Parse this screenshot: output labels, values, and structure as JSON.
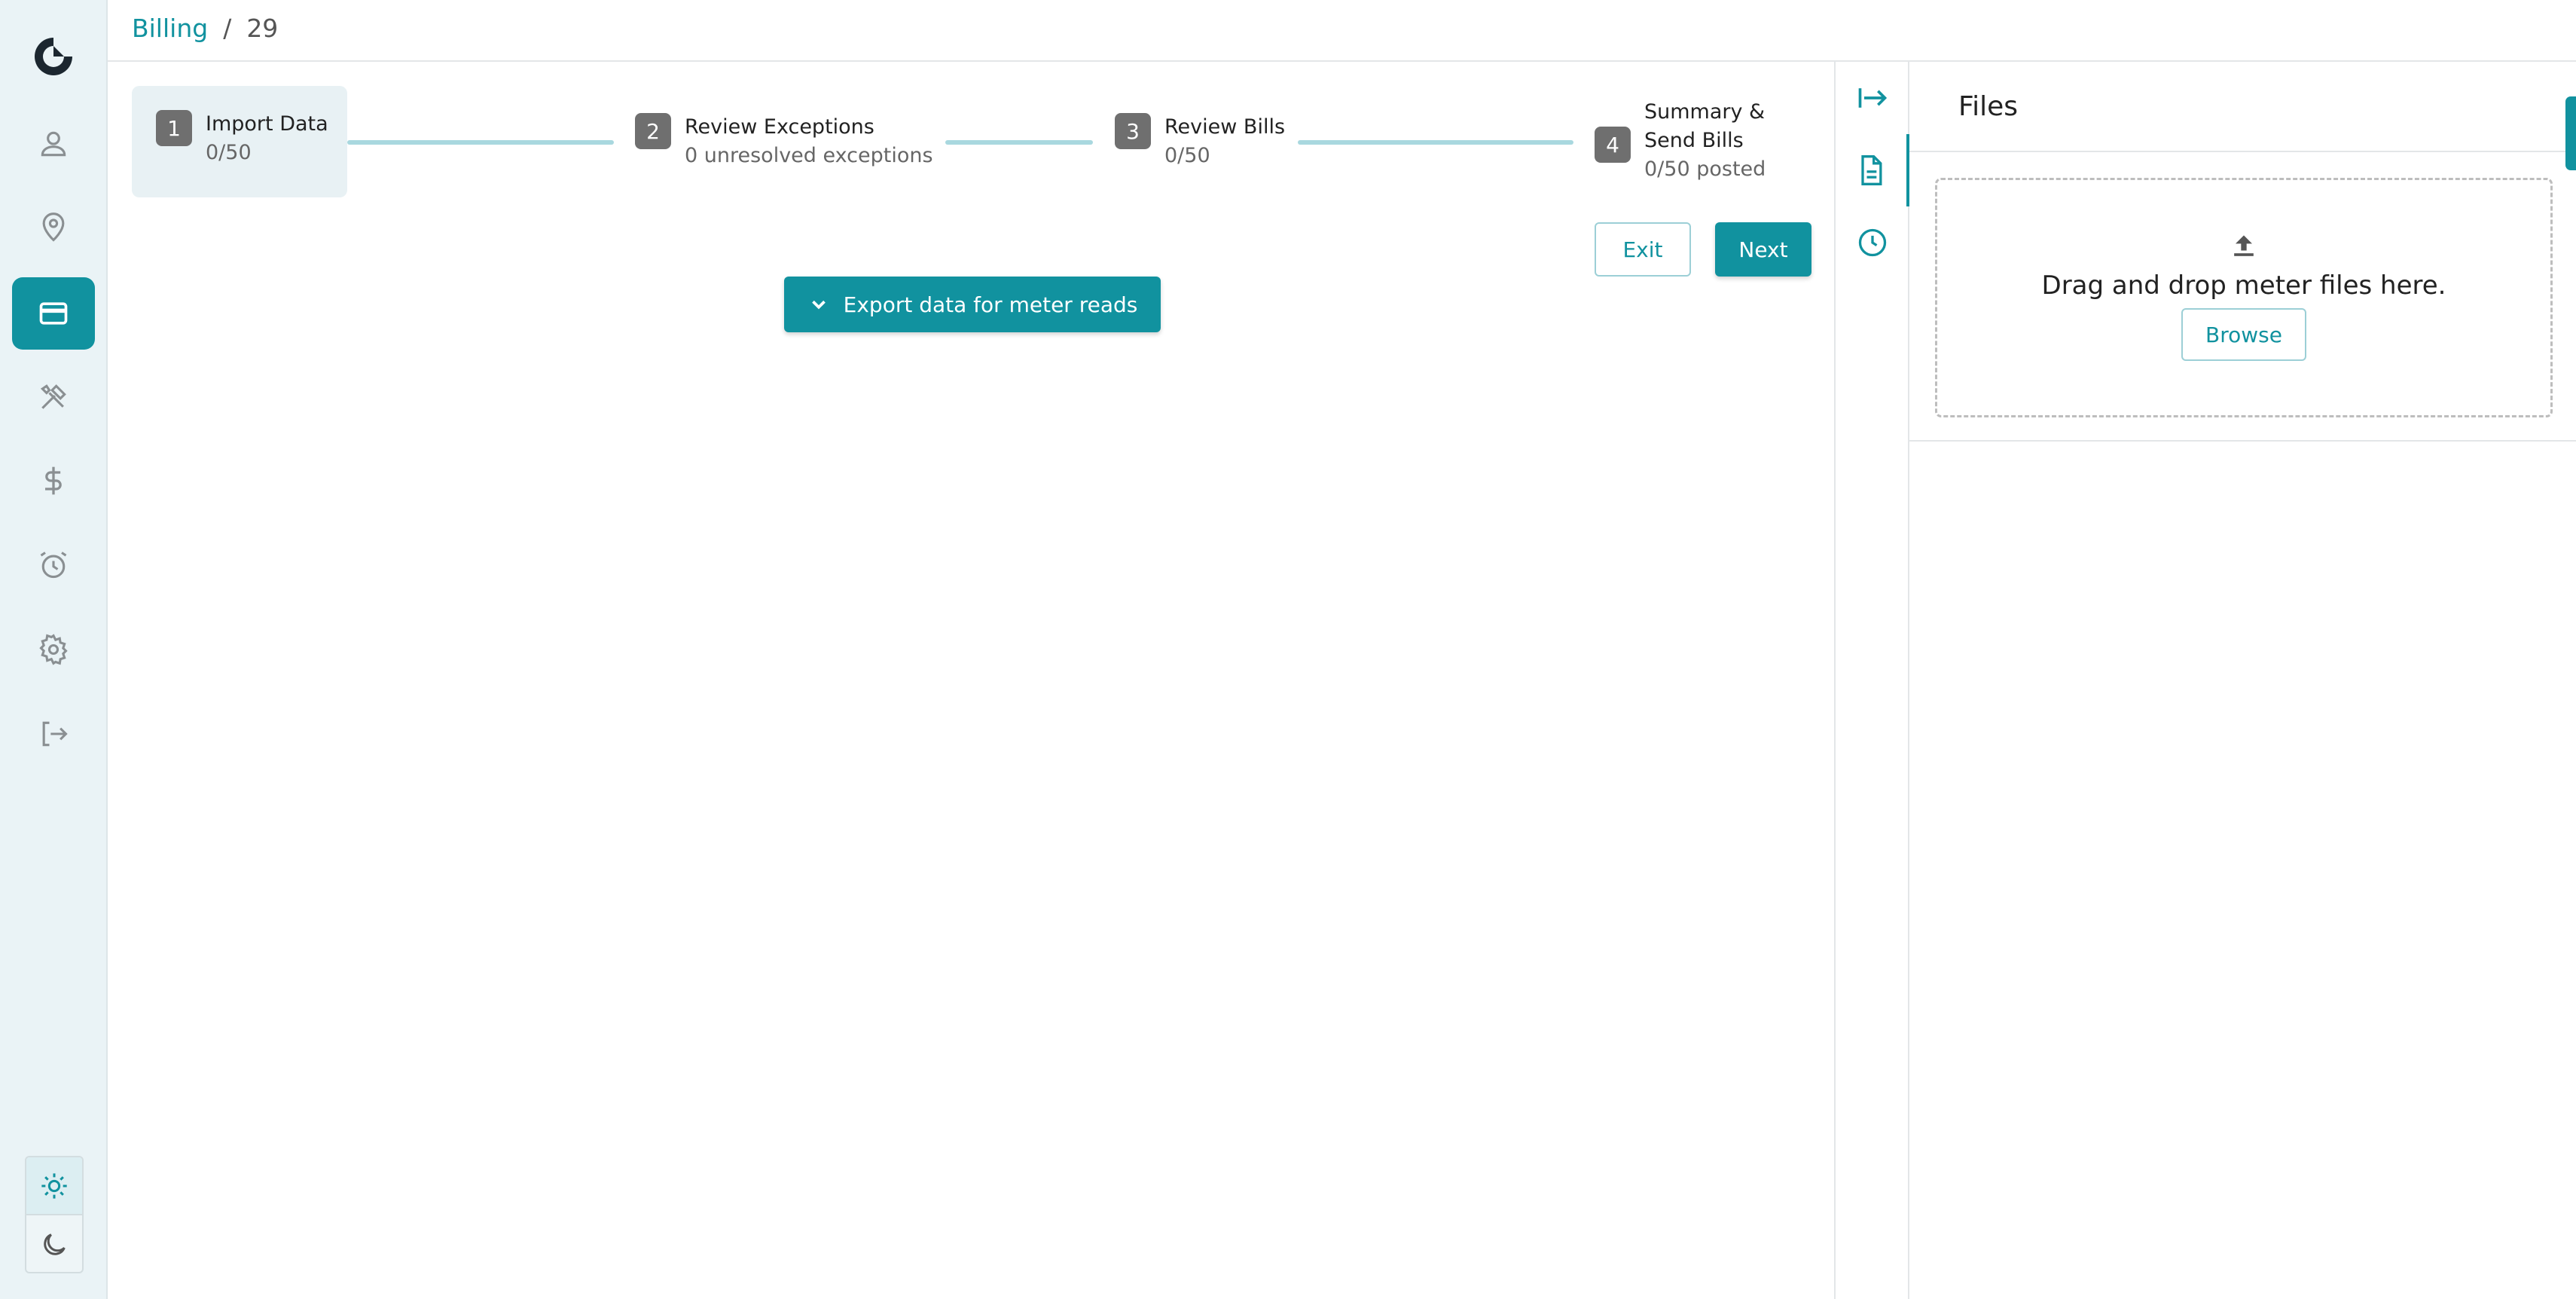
{
  "breadcrumb": {
    "section": "Billing",
    "separator": "/",
    "current": "29"
  },
  "sidebar": {
    "items": [
      {
        "name": "user-icon"
      },
      {
        "name": "location-icon"
      },
      {
        "name": "credit-card-icon",
        "active": true
      },
      {
        "name": "tools-icon"
      },
      {
        "name": "dollar-icon"
      },
      {
        "name": "alarm-clock-icon"
      },
      {
        "name": "gear-icon"
      },
      {
        "name": "logout-icon"
      }
    ],
    "theme": {
      "light": "sun-icon",
      "dark": "moon-icon",
      "selected": "light"
    }
  },
  "steps": [
    {
      "number": "1",
      "title": "Import Data",
      "sub": "0/50",
      "active": true
    },
    {
      "number": "2",
      "title": "Review Exceptions",
      "sub": "0 unresolved exceptions"
    },
    {
      "number": "3",
      "title": "Review Bills",
      "sub": "0/50"
    },
    {
      "number": "4",
      "title_line1": "Summary &",
      "title_line2": "Send Bills",
      "sub": "0/50 posted"
    }
  ],
  "actions": {
    "exit": "Exit",
    "next": "Next",
    "export": "Export data for meter reads"
  },
  "rail": {
    "items": [
      "collapse-arrow-icon",
      "file-icon",
      "clock-icon"
    ],
    "active": "file-icon"
  },
  "files": {
    "title": "Files",
    "drop_text": "Drag and drop meter files here.",
    "browse": "Browse"
  },
  "colors": {
    "accent": "#11929f",
    "sidebar_bg": "#eaf3f6",
    "step_active_bg": "#e8f1f4",
    "connector": "#a9d8df"
  }
}
